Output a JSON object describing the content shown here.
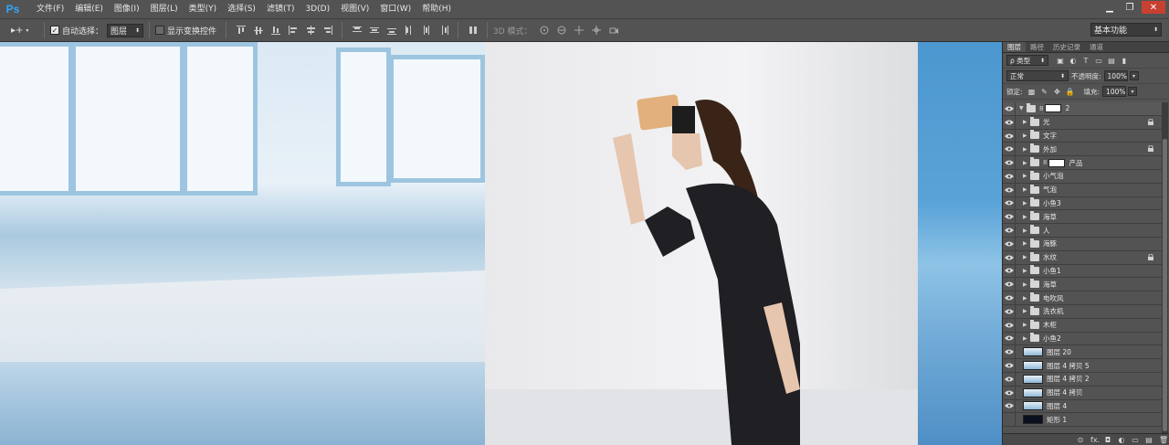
{
  "app": {
    "logo": "Ps"
  },
  "menu": [
    "文件(F)",
    "编辑(E)",
    "图像(I)",
    "图层(L)",
    "类型(Y)",
    "选择(S)",
    "滤镜(T)",
    "3D(D)",
    "视图(V)",
    "窗口(W)",
    "帮助(H)"
  ],
  "window_controls": {
    "minimize": "▁",
    "maximize": "❐",
    "close": "✕"
  },
  "options": {
    "move_tool_glyph": "▸+",
    "auto_select_label": "自动选择：",
    "auto_select_checked": true,
    "auto_select_target": "图层",
    "show_transform_label": "显示变换控件",
    "show_transform_checked": false,
    "mode_3d_label": "3D 模式：",
    "workspace": "基本功能"
  },
  "panel": {
    "tabs": [
      "图层",
      "路径",
      "历史记录",
      "通道"
    ],
    "filter_kind": "ρ 类型",
    "blend_mode": "正常",
    "opacity_label": "不透明度:",
    "opacity_value": "100%",
    "lock_label": "锁定:",
    "fill_label": "填充:",
    "fill_value": "100%"
  },
  "layers": [
    {
      "name": "2",
      "type": "group-open-mask",
      "locked": false,
      "visible": true
    },
    {
      "name": "光",
      "type": "group",
      "locked": true,
      "visible": true
    },
    {
      "name": "文字",
      "type": "group",
      "locked": false,
      "visible": true
    },
    {
      "name": "外加",
      "type": "group",
      "locked": true,
      "visible": true
    },
    {
      "name": "产品",
      "type": "group-mask",
      "locked": false,
      "visible": true
    },
    {
      "name": "小气泡",
      "type": "group",
      "locked": false,
      "visible": true
    },
    {
      "name": "气泡",
      "type": "group",
      "locked": false,
      "visible": true
    },
    {
      "name": "小鱼3",
      "type": "group",
      "locked": false,
      "visible": true
    },
    {
      "name": "海草",
      "type": "group",
      "locked": false,
      "visible": true
    },
    {
      "name": "人",
      "type": "group",
      "locked": false,
      "visible": true
    },
    {
      "name": "海豚",
      "type": "group",
      "locked": false,
      "visible": true
    },
    {
      "name": "水纹",
      "type": "group",
      "locked": true,
      "visible": true
    },
    {
      "name": "小鱼1",
      "type": "group",
      "locked": false,
      "visible": true
    },
    {
      "name": "海草",
      "type": "group",
      "locked": false,
      "visible": true
    },
    {
      "name": "电吹风",
      "type": "group",
      "locked": false,
      "visible": true
    },
    {
      "name": "洗衣机",
      "type": "group",
      "locked": false,
      "visible": true
    },
    {
      "name": "木柜",
      "type": "group",
      "locked": false,
      "visible": true
    },
    {
      "name": "小鱼2",
      "type": "group",
      "locked": false,
      "visible": true
    },
    {
      "name": "图层 20",
      "type": "image",
      "locked": false,
      "visible": true
    },
    {
      "name": "图层 4 拷贝 5",
      "type": "image",
      "locked": false,
      "visible": true
    },
    {
      "name": "图层 4 拷贝 2",
      "type": "image",
      "locked": false,
      "visible": true
    },
    {
      "name": "图层 4 拷贝",
      "type": "image",
      "locked": false,
      "visible": true
    },
    {
      "name": "图层 4",
      "type": "image",
      "locked": false,
      "visible": true
    },
    {
      "name": "矩形 1",
      "type": "shape",
      "locked": false,
      "visible": false
    }
  ],
  "bottom_icons": [
    "⊙",
    "fx.",
    "◘",
    "◐",
    "▭",
    "▤",
    "🗑"
  ]
}
